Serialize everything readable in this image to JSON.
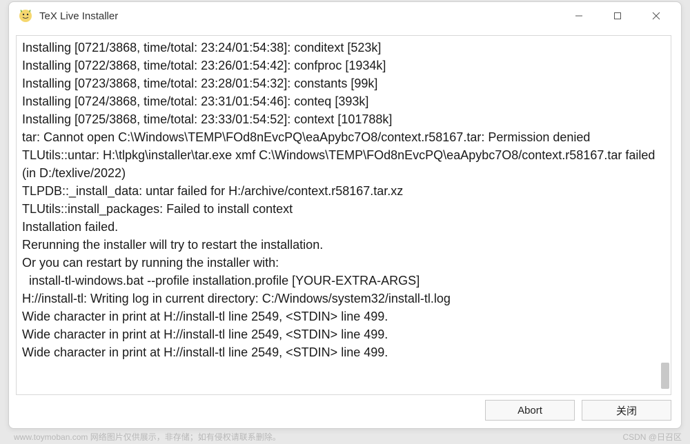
{
  "window": {
    "title": "TeX Live Installer"
  },
  "log": {
    "lines": [
      "Installing [0721/3868, time/total: 23:24/01:54:38]: conditext [523k]",
      "Installing [0722/3868, time/total: 23:26/01:54:42]: confproc [1934k]",
      "Installing [0723/3868, time/total: 23:28/01:54:32]: constants [99k]",
      "Installing [0724/3868, time/total: 23:31/01:54:46]: conteq [393k]",
      "Installing [0725/3868, time/total: 23:33/01:54:52]: context [101788k]",
      "tar: Cannot open C:\\Windows\\TEMP\\FOd8nEvcPQ\\eaApybc7O8/context.r58167.tar: Permission denied",
      "TLUtils::untar: H:\\tlpkg\\installer\\tar.exe xmf C:\\Windows\\TEMP\\FOd8nEvcPQ\\eaApybc7O8/context.r58167.tar failed (in D:/texlive/2022)",
      "TLPDB::_install_data: untar failed for H:/archive/context.r58167.tar.xz",
      "TLUtils::install_packages: Failed to install context",
      "Installation failed.",
      "Rerunning the installer will try to restart the installation.",
      "Or you can restart by running the installer with:",
      "  install-tl-windows.bat --profile installation.profile [YOUR-EXTRA-ARGS]",
      "H://install-tl: Writing log in current directory: C:/Windows/system32/install-tl.log",
      "Wide character in print at H://install-tl line 2549, <STDIN> line 499.",
      "Wide character in print at H://install-tl line 2549, <STDIN> line 499.",
      "Wide character in print at H://install-tl line 2549, <STDIN> line 499."
    ]
  },
  "buttons": {
    "abort": "Abort",
    "close": "关闭"
  },
  "footer": {
    "left": "www.toymoban.com  网络图片仅供展示，非存储；如有侵权请联系删除。",
    "right": "CSDN @日召区"
  }
}
